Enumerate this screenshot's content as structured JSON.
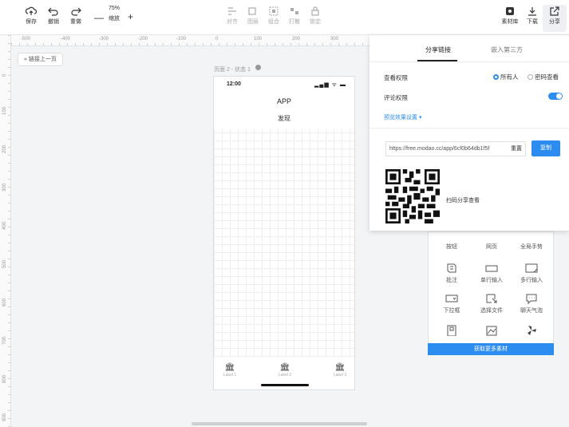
{
  "toolbar": {
    "left": [
      {
        "label": "保存",
        "icon": "cloud-upload-icon"
      },
      {
        "label": "撤销",
        "icon": "undo-icon"
      },
      {
        "label": "重做",
        "icon": "redo-icon"
      }
    ],
    "zoom": {
      "value": "75%",
      "label": "缩放",
      "minus": "—",
      "plus": "+"
    },
    "center": [
      {
        "label": "对齐",
        "icon": "align-icon"
      },
      {
        "label": "图层",
        "icon": "layer-icon"
      },
      {
        "label": "组合",
        "icon": "group-icon"
      },
      {
        "label": "打散",
        "icon": "ungroup-icon"
      },
      {
        "label": "锁定",
        "icon": "lock-icon"
      }
    ],
    "right": [
      {
        "label": "素材库",
        "icon": "material-library-icon"
      },
      {
        "label": "下载",
        "icon": "download-icon"
      },
      {
        "label": "分享",
        "icon": "share-icon"
      }
    ]
  },
  "ruler": {
    "top_ticks": [
      "-500",
      "-400",
      "-300",
      "-200",
      "-100",
      "0",
      "100",
      "200",
      "300"
    ],
    "left_ticks": [
      "0",
      "100",
      "200",
      "300",
      "400",
      "500",
      "600",
      "700",
      "800",
      "900"
    ]
  },
  "back_button": "« 链接上一页",
  "artboard": {
    "label": "页面 2 - 状态 1",
    "status_time": "12:00",
    "status_icons": "▂▄▆ ᯤ ▬",
    "app_name": "APP",
    "app_sub": "发现",
    "tabs": [
      {
        "icon": "bank-icon",
        "glyph": "🏛",
        "label": "Label 1"
      },
      {
        "icon": "bank-icon",
        "glyph": "🏛",
        "label": "Label 2"
      },
      {
        "icon": "bank-icon",
        "glyph": "🏛",
        "label": "Label 3"
      }
    ]
  },
  "components": {
    "header": [
      "按钮",
      "网页",
      "全局手势"
    ],
    "items": [
      {
        "label": "批注",
        "icon": "annotation-icon"
      },
      {
        "label": "单行输入",
        "icon": "single-line-input-icon"
      },
      {
        "label": "多行输入",
        "icon": "multi-line-input-icon"
      },
      {
        "label": "下拉框",
        "icon": "dropdown-icon"
      },
      {
        "label": "选择文件",
        "icon": "file-select-icon"
      },
      {
        "label": "聊天气泡",
        "icon": "chat-bubble-icon"
      },
      {
        "label": "",
        "icon": "phone-icon"
      },
      {
        "label": "",
        "icon": "image-icon"
      },
      {
        "label": "",
        "icon": "fan-icon"
      }
    ],
    "more_button": "获取更多素材"
  },
  "share": {
    "tab_active": "分享链接",
    "tab_inactive": "嵌入第三方",
    "view_permission_label": "查看权限",
    "radio_all": "所有人",
    "radio_password": "密码查看",
    "comment_permission_label": "评论权限",
    "comment_enabled": true,
    "preview_settings": "预览效果设置 ▾",
    "url": "https://free.modao.cc/app/6cf0b64db1f5f",
    "reset_label": "重置",
    "copy_label": "复制",
    "qr_text": "扫码分享查看"
  },
  "colors": {
    "accent": "#2d8cf0"
  }
}
